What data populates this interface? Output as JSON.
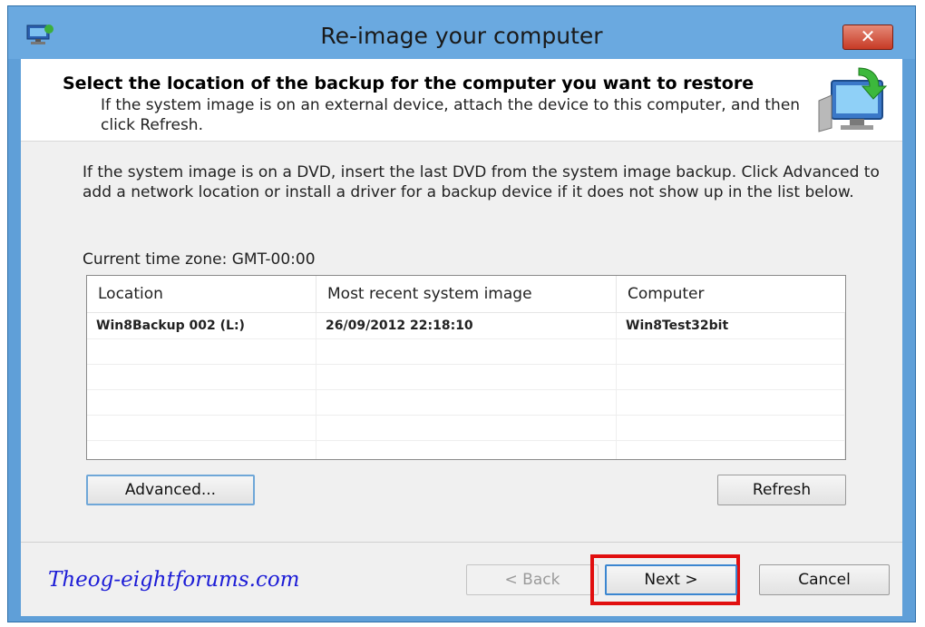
{
  "window": {
    "title": "Re-image your computer",
    "close_symbol": "✕"
  },
  "header": {
    "title": "Select the location of the backup for the computer you want to restore",
    "subtitle": "If the system image is on an external device, attach the device to this computer, and then click Refresh.",
    "icon": "monitor-restore-icon"
  },
  "description": "If the system image is on a DVD, insert the last DVD from the system image backup. Click Advanced to add a network location or install a driver for a backup device if it does not show up in the list below.",
  "time_zone": "Current time zone: GMT-00:00",
  "table": {
    "columns": [
      "Location",
      "Most recent system image",
      "Computer"
    ],
    "rows": [
      {
        "location": "Win8Backup 002 (L:)",
        "image": "26/09/2012  22:18:10",
        "computer": "Win8Test32bit"
      },
      {
        "location": "",
        "image": "",
        "computer": ""
      },
      {
        "location": "",
        "image": "",
        "computer": ""
      },
      {
        "location": "",
        "image": "",
        "computer": ""
      },
      {
        "location": "",
        "image": "",
        "computer": ""
      },
      {
        "location": "",
        "image": "",
        "computer": ""
      }
    ]
  },
  "buttons": {
    "advanced": "Advanced...",
    "refresh": "Refresh",
    "back": "< Back",
    "next": "Next >",
    "cancel": "Cancel"
  },
  "watermark": "Theog-eightforums.com",
  "colors": {
    "highlight": "#e10f0f",
    "watermark": "#1c1cd6",
    "title_bar": "#6aa9e0"
  }
}
